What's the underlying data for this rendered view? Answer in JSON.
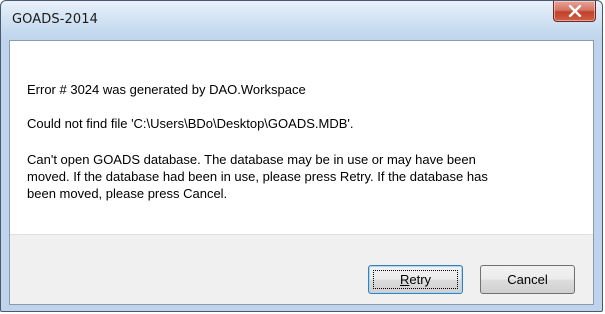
{
  "window": {
    "title": "GOADS-2014"
  },
  "icons": {
    "close": "close-icon"
  },
  "message": {
    "line1": "Error # 3024 was generated by DAO.Workspace",
    "line2": "Could not find file 'C:\\Users\\BDo\\Desktop\\GOADS.MDB'.",
    "line3a": "Can't open GOADS database.  The database may be in use or may have been",
    "line3b": "moved.  If the database had been in use, please press Retry. If the database has",
    "line3c": "been moved, please press Cancel."
  },
  "buttons": {
    "retry_mnemonic": "R",
    "retry_rest": "etry",
    "cancel": "Cancel"
  },
  "colors": {
    "close_button": "#c2412b",
    "title_bar": "#c6daef",
    "button_bar": "#f0f0f0"
  }
}
